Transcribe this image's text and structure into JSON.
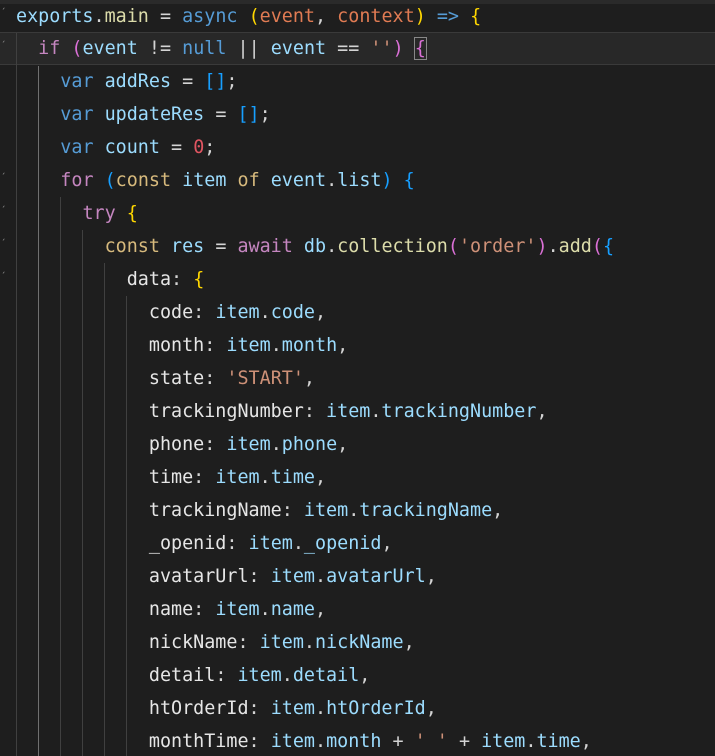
{
  "editor": {
    "language": "javascript",
    "lines": [
      "exports.main = async (event, context) => {",
      "  if (event != null || event == '') {",
      "    var addRes = [];",
      "    var updateRes = [];",
      "    var count = 0;",
      "    for (const item of event.list) {",
      "      try {",
      "        const res = await db.collection('order').add({",
      "          data: {",
      "            code: item.code,",
      "            month: item.month,",
      "            state: 'START',",
      "            trackingNumber: item.trackingNumber,",
      "            phone: item.phone,",
      "            time: item.time,",
      "            trackingName: item.trackingName,",
      "            _openid: item._openid,",
      "            avatarUrl: item.avatarUrl,",
      "            name: item.name,",
      "            nickName: item.nickName,",
      "            detail: item.detail,",
      "            htOrderId: item.htOrderId,",
      "            monthTime: item.month + ' ' + item.time,"
    ],
    "t": {
      "exports": "exports",
      "main": "main",
      "async": "async",
      "event": "event",
      "context": "context",
      "if": "if",
      "null": "null",
      "empty_str": "''",
      "var": "var",
      "addRes": "addRes",
      "updateRes": "updateRes",
      "count": "count",
      "zero": "0",
      "for": "for",
      "const": "const",
      "item": "item",
      "of": "of",
      "list": "list",
      "try": "try",
      "res": "res",
      "await": "await",
      "db": "db",
      "collection": "collection",
      "order_str": "'order'",
      "add": "add",
      "data": "data",
      "code": "code",
      "month": "month",
      "state": "state",
      "start_str": "'START'",
      "trackingNumber": "trackingNumber",
      "phone": "phone",
      "time": "time",
      "trackingName": "trackingName",
      "openid": "_openid",
      "avatarUrl": "avatarUrl",
      "name": "name",
      "nickName": "nickName",
      "detail": "detail",
      "htOrderId": "htOrderId",
      "monthTime": "monthTime",
      "space_str": "' '"
    }
  }
}
